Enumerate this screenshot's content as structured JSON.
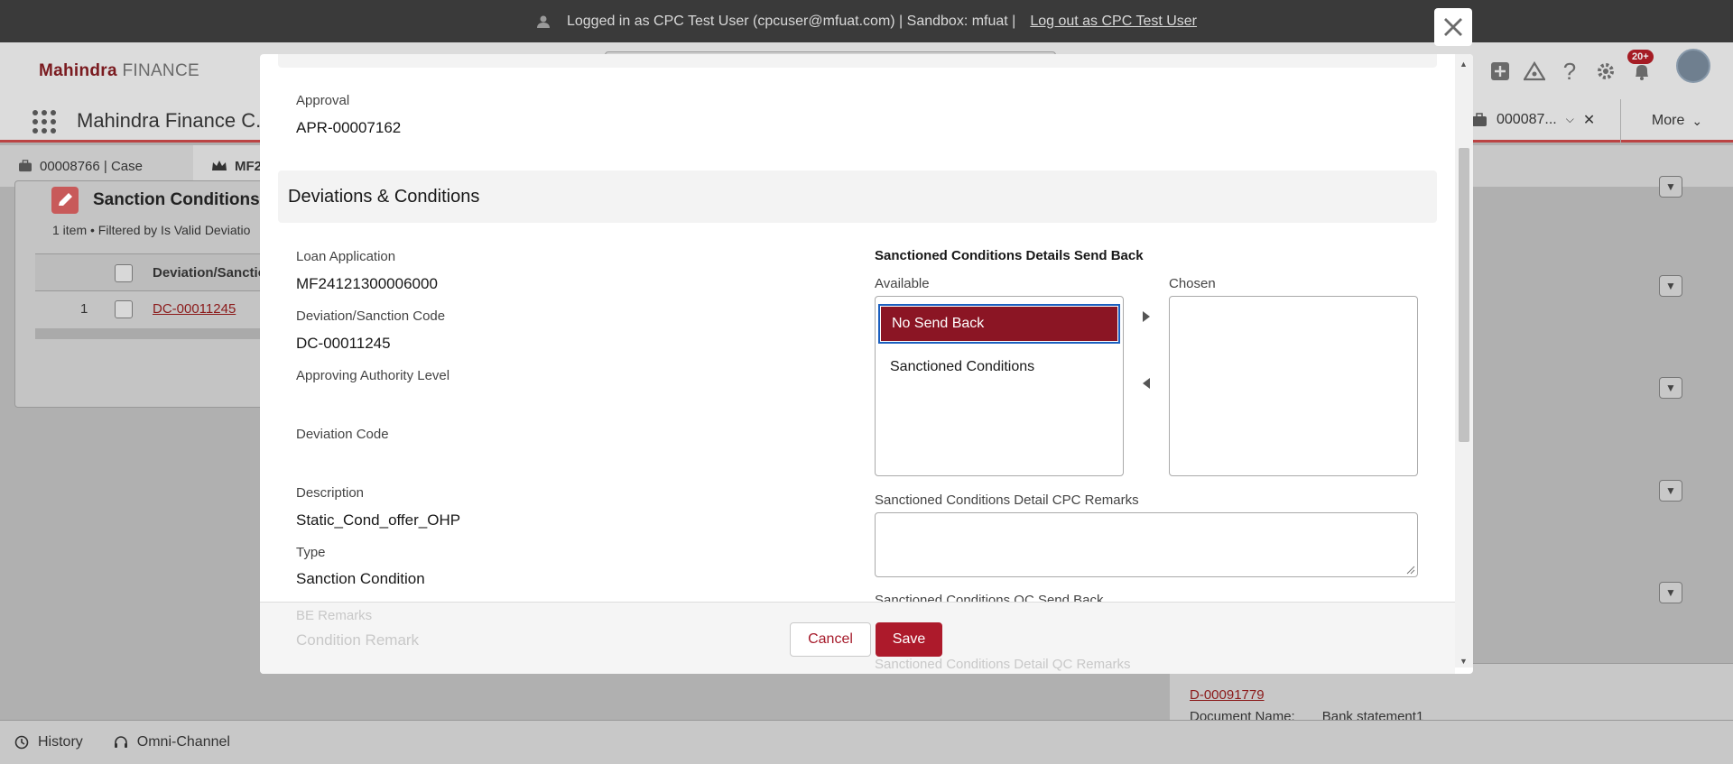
{
  "login_bar": {
    "text": "Logged in as CPC Test User (cpcuser@mfuat.com) | Sandbox: mfuat |",
    "logout": "Log out as CPC Test User"
  },
  "header": {
    "logo_brand": "Mahindra",
    "logo_suffix": "FINANCE",
    "notification_count": "20+",
    "icons": [
      "add-icon",
      "trailhead-icon",
      "help-icon",
      "setup-gear-icon",
      "notification-bell-icon"
    ]
  },
  "nav": {
    "app_name": "Mahindra Finance C...",
    "open_tab": "000087...",
    "more": "More"
  },
  "workspace_tabs": [
    {
      "label": "00008766 | Case"
    },
    {
      "label": "MF2"
    }
  ],
  "background_list": {
    "title": "Sanction Conditions",
    "subtitle": "1 item • Filtered by Is Valid Deviatio",
    "column": "Deviation/Sanctio",
    "row_number": "1",
    "row_link": "DC-00011245"
  },
  "right_card": {
    "link": "D-00091779",
    "doc_label": "Document Name:",
    "doc_value": "Bank statement1"
  },
  "utility_bar": {
    "history": "History",
    "omni": "Omni-Channel"
  },
  "modal": {
    "approval_label": "Approval",
    "approval_value": "APR-00007162",
    "section_title": "Deviations & Conditions",
    "left_fields": [
      {
        "label": "Loan Application",
        "value": "MF24121300006000"
      },
      {
        "label": "Deviation/Sanction Code",
        "value": "DC-00011245"
      },
      {
        "label": "Approving Authority Level",
        "value": ""
      },
      {
        "label": "Deviation Code",
        "value": ""
      },
      {
        "label": "Description",
        "value": "Static_Cond_offer_OHP"
      },
      {
        "label": "Type",
        "value": "Sanction Condition"
      },
      {
        "label": "BE Remarks",
        "value": "Condition Remark"
      }
    ],
    "dual_listbox": {
      "title": "Sanctioned Conditions Details Send Back",
      "available_label": "Available",
      "chosen_label": "Chosen",
      "available_options": [
        "No Send Back",
        "Sanctioned Conditions"
      ],
      "selected_option": "No Send Back",
      "chosen_options": []
    },
    "cpc_remarks_label": "Sanctioned Conditions Detail CPC Remarks",
    "cpc_remarks_value": "",
    "qc_send_back_label": "Sanctioned Conditions QC Send Back",
    "qc_remarks_label": "Sanctioned Conditions Detail QC Remarks",
    "cancel": "Cancel",
    "save": "Save"
  },
  "colors": {
    "brand": "#ad1a2b",
    "selected_option": "#8b1524",
    "focus_ring": "#1b5fbf"
  }
}
